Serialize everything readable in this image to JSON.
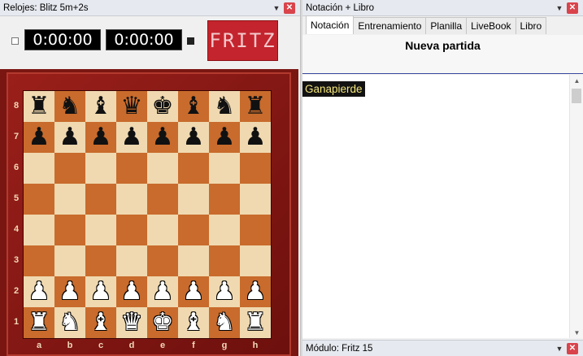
{
  "clocks_pane": {
    "title": "Relojes: Blitz 5m+2s",
    "white_time": "0:00:00",
    "black_time": "0:00:00",
    "logo_text": "FRITZ"
  },
  "board": {
    "ranks": [
      "8",
      "7",
      "6",
      "5",
      "4",
      "3",
      "2",
      "1"
    ],
    "files": [
      "a",
      "b",
      "c",
      "d",
      "e",
      "f",
      "g",
      "h"
    ],
    "position": [
      [
        "r",
        "n",
        "b",
        "q",
        "k",
        "b",
        "n",
        "r"
      ],
      [
        "p",
        "p",
        "p",
        "p",
        "p",
        "p",
        "p",
        "p"
      ],
      [
        "",
        "",
        "",
        "",
        "",
        "",
        "",
        ""
      ],
      [
        "",
        "",
        "",
        "",
        "",
        "",
        "",
        ""
      ],
      [
        "",
        "",
        "",
        "",
        "",
        "",
        "",
        ""
      ],
      [
        "",
        "",
        "",
        "",
        "",
        "",
        "",
        ""
      ],
      [
        "P",
        "P",
        "P",
        "P",
        "P",
        "P",
        "P",
        "P"
      ],
      [
        "R",
        "N",
        "B",
        "Q",
        "K",
        "B",
        "N",
        "R"
      ]
    ],
    "colors": {
      "light": "#f0d9b0",
      "dark": "#c86b2c",
      "frame": "#7a1612"
    }
  },
  "notation_pane": {
    "title": "Notación + Libro",
    "tabs": [
      "Notación",
      "Entrenamiento",
      "Planilla",
      "LiveBook",
      "Libro"
    ],
    "active_tab": "Notación",
    "game_title": "Nueva partida",
    "variant": "Ganapierde"
  },
  "engine_pane": {
    "title": "Módulo: Fritz 15"
  }
}
